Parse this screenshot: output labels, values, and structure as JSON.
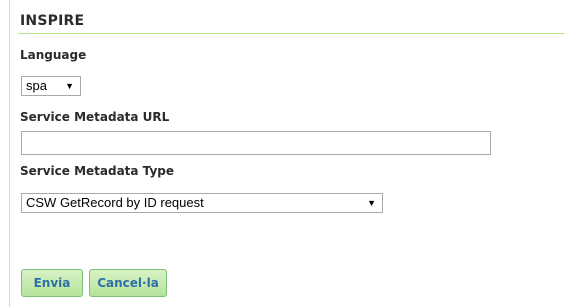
{
  "section": {
    "title": "INSPIRE"
  },
  "language": {
    "label": "Language",
    "selected": "spa"
  },
  "service_metadata_url": {
    "label": "Service Metadata URL",
    "value": ""
  },
  "service_metadata_type": {
    "label": "Service Metadata Type",
    "selected": "CSW GetRecord by ID request"
  },
  "actions": {
    "submit_label": "Envia",
    "cancel_label": "Cancel·la"
  },
  "icons": {
    "dropdown": "chevron-down-icon"
  },
  "colors": {
    "title_rule": "#bfe08a",
    "button_bg": "#c6eaae",
    "button_text": "#2f6fa8"
  }
}
